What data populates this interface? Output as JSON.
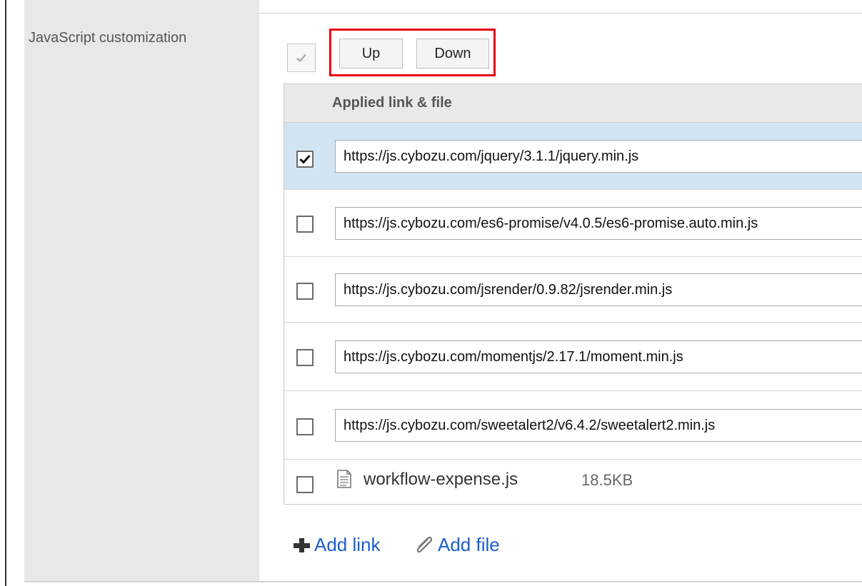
{
  "setting": {
    "label": "JavaScript customization"
  },
  "toolbar": {
    "up_label": "Up",
    "down_label": "Down"
  },
  "table": {
    "header": "Applied link & file",
    "rows": [
      {
        "type": "link",
        "value": "https://js.cybozu.com/jquery/3.1.1/jquery.min.js",
        "checked": true
      },
      {
        "type": "link",
        "value": "https://js.cybozu.com/es6-promise/v4.0.5/es6-promise.auto.min.js",
        "checked": false
      },
      {
        "type": "link",
        "value": "https://js.cybozu.com/jsrender/0.9.82/jsrender.min.js",
        "checked": false
      },
      {
        "type": "link",
        "value": "https://js.cybozu.com/momentjs/2.17.1/moment.min.js",
        "checked": false
      },
      {
        "type": "link",
        "value": "https://js.cybozu.com/sweetalert2/v6.4.2/sweetalert2.min.js",
        "checked": false
      },
      {
        "type": "file",
        "name": "workflow-expense.js",
        "size": "18.5KB",
        "icon": "document-icon",
        "checked": false
      }
    ]
  },
  "actions": {
    "add_link_label": "Add link",
    "add_link_icon": "plus-icon",
    "add_file_label": "Add file",
    "add_file_icon": "paperclip-icon"
  },
  "colors": {
    "highlight": "#e60012",
    "selected_row": "#d2e5f2",
    "link": "#1a5ecf"
  }
}
